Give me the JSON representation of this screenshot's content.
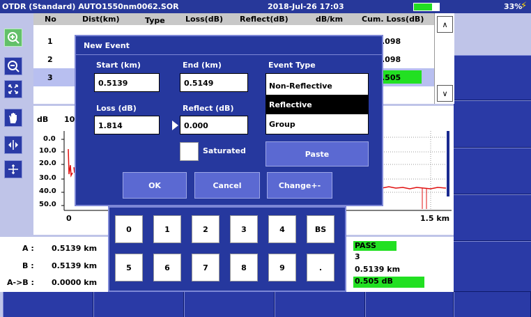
{
  "topbar": {
    "title": "OTDR (Standard) AUTO1550nm0062.SOR",
    "datetime": "2018-Jul-26 17:03",
    "battery": "33%"
  },
  "toolbar": {
    "tools": [
      "zoom-in-icon",
      "zoom-out-icon",
      "fit-icon",
      "pan-hand-icon",
      "horizontal-scale-icon",
      "vertical-scale-icon"
    ]
  },
  "table": {
    "headers": [
      "No",
      "Dist(km)",
      "Type",
      "Loss(dB)",
      "Reflect(dB)",
      "dB/km",
      "Cum. Loss(dB)"
    ],
    "rows": [
      {
        "no": "1",
        "cum": ".098"
      },
      {
        "no": "2",
        "cum": ".098"
      },
      {
        "no": "3",
        "cum": ".505"
      }
    ]
  },
  "graph": {
    "ylabel": "dB",
    "ticks_y": [
      "0.0",
      "10.0",
      "20.0",
      "30.0",
      "40.0",
      "50.0"
    ],
    "x_start": "0",
    "x_partial": "10",
    "x_end": "1.5 km"
  },
  "info": {
    "a_label": "A :",
    "a_value": "0.5139 km",
    "b_label": "B :",
    "b_value": "0.5139 km",
    "ab_label": "A->B :",
    "ab_value": "0.0000 km",
    "status": "PASS",
    "event_no": "3",
    "event_dist": "0.5139 km",
    "event_loss": "0.505 dB"
  },
  "dialog": {
    "title": "New Event",
    "start_label": "Start (km)",
    "start_value": "0.5139",
    "end_label": "End (km)",
    "end_value": "0.5149",
    "loss_label": "Loss (dB)",
    "loss_value": "1.814",
    "reflect_label": "Reflect (dB)",
    "reflect_value": "0.000",
    "event_type_label": "Event Type",
    "event_types": [
      "Non-Reflective",
      "Reflective",
      "Group"
    ],
    "selected_event_type": "Reflective",
    "saturated_label": "Saturated",
    "paste_label": "Paste",
    "ok_label": "OK",
    "cancel_label": "Cancel",
    "change_label": "Change+-"
  },
  "keypad": {
    "keys": [
      "0",
      "1",
      "2",
      "3",
      "4",
      "BS",
      "5",
      "6",
      "7",
      "8",
      "9",
      "."
    ]
  },
  "colors": {
    "header_blue": "#27389a",
    "dialog_blue": "#26389e",
    "button_blue": "#5b69d2",
    "highlight_green": "#22e022",
    "trace_red": "#e01010"
  }
}
